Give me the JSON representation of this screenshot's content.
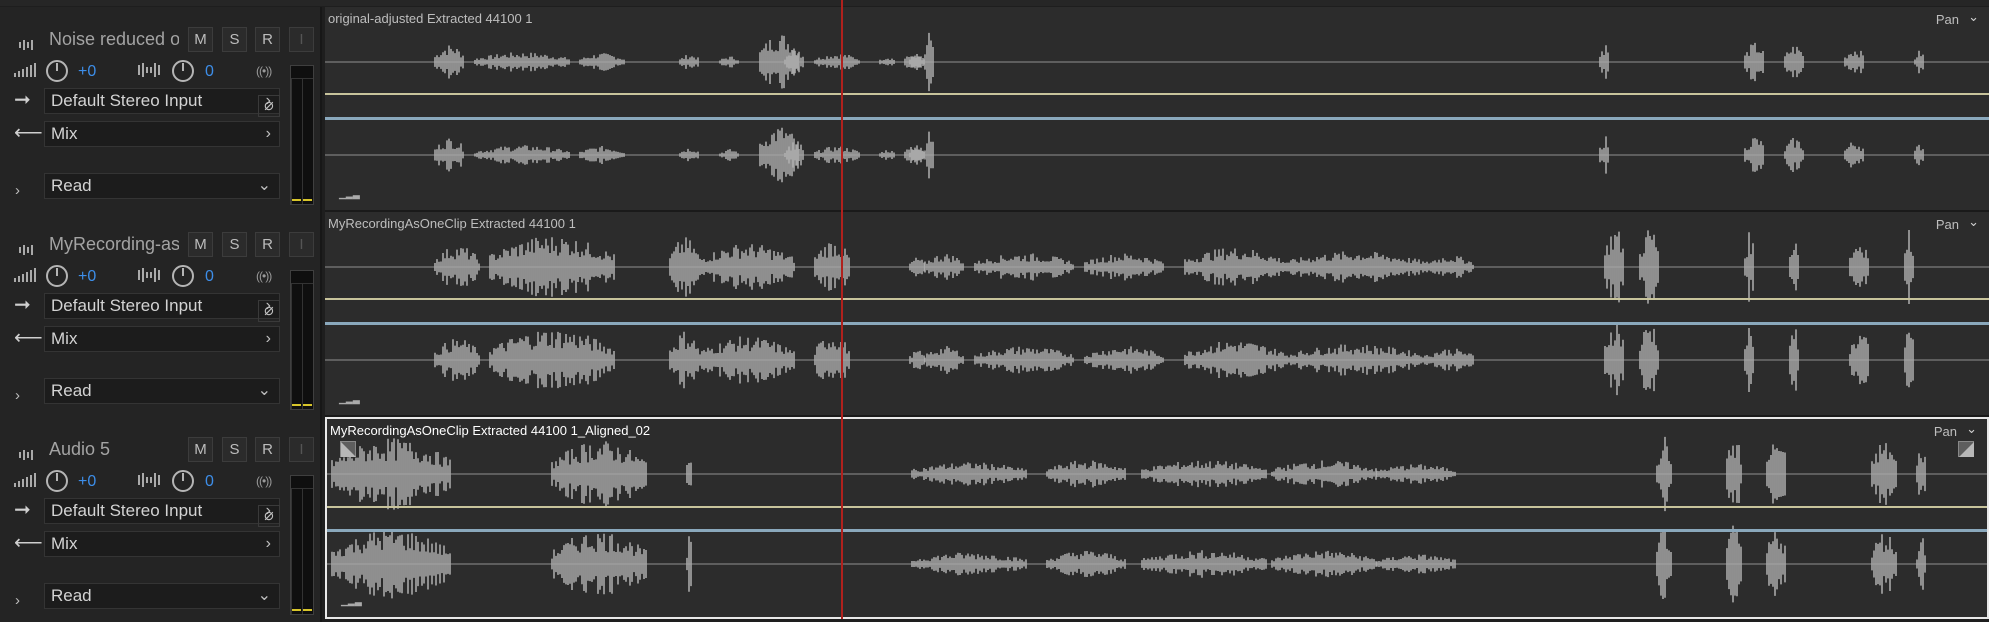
{
  "tracks": [
    {
      "name": "Noise reduced ori",
      "mute": "M",
      "solo": "S",
      "record": "R",
      "monitor": "I",
      "volume": "+0",
      "pan": "0",
      "input": "Default Stereo Input",
      "output": "Mix",
      "automation": "Read",
      "clip_name": "original-adjusted Extracted 44100 1",
      "pan_label": "Pan",
      "selected": false
    },
    {
      "name": "MyRecording-as-",
      "mute": "M",
      "solo": "S",
      "record": "R",
      "monitor": "I",
      "volume": "+0",
      "pan": "0",
      "input": "Default Stereo Input",
      "output": "Mix",
      "automation": "Read",
      "clip_name": "MyRecordingAsOneClip Extracted 44100 1",
      "pan_label": "Pan",
      "selected": false
    },
    {
      "name": "Audio 5",
      "mute": "M",
      "solo": "S",
      "record": "R",
      "monitor": "I",
      "volume": "+0",
      "pan": "0",
      "input": "Default Stereo Input",
      "output": "Mix",
      "automation": "Read",
      "clip_name": "MyRecordingAsOneClip Extracted 44100 1_Aligned_02",
      "pan_label": "Pan",
      "selected": true
    }
  ],
  "colors": {
    "volume_value": "#3d8ee9",
    "playhead": "#b0211d",
    "volume_envelope": "#c7c39b",
    "pan_envelope": "#8aa8bc",
    "waveform": "#a8a8a8",
    "meter_level": "#d8c52a"
  }
}
